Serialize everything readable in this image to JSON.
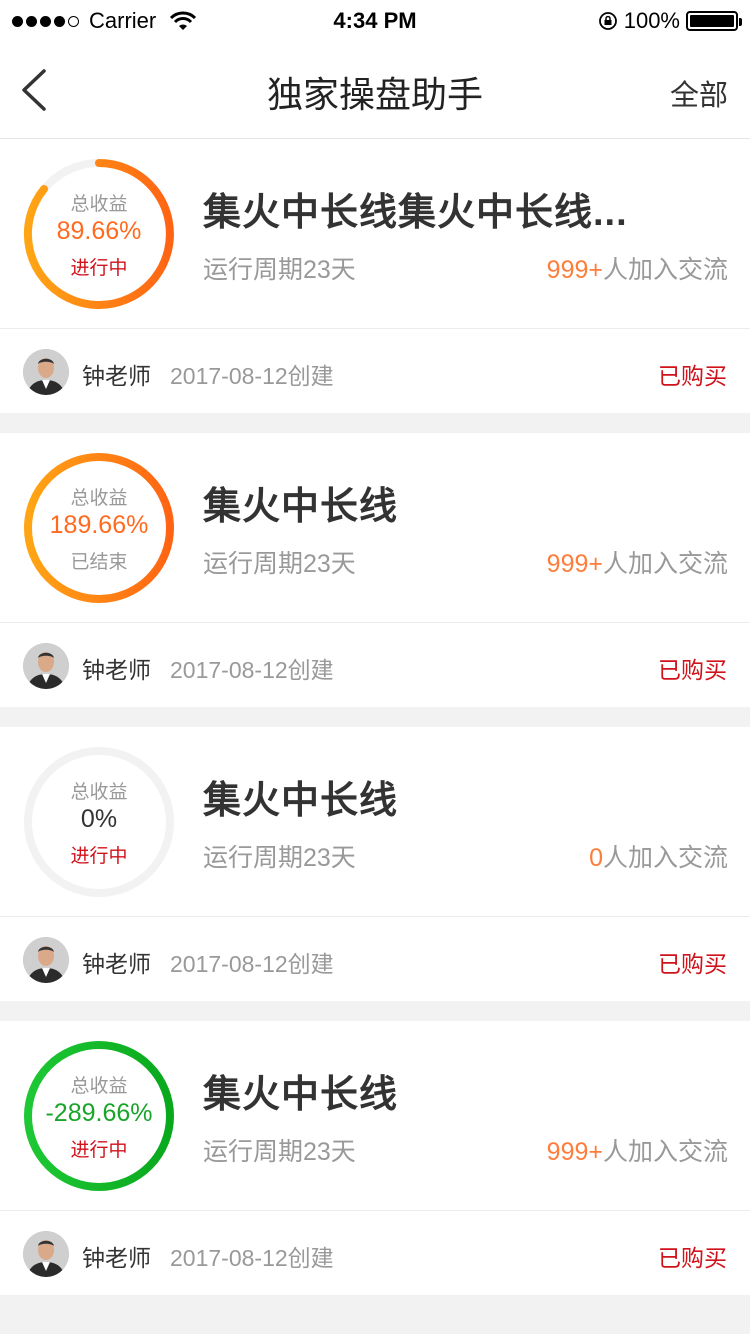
{
  "status_bar": {
    "carrier": "Carrier",
    "time": "4:34 PM",
    "battery": "100%"
  },
  "nav": {
    "title": "独家操盘助手",
    "right": "全部"
  },
  "colors": {
    "orange": "#ff7c3a",
    "green": "#19a52a",
    "red": "#d0121b",
    "gray": "#999999"
  },
  "cards": [
    {
      "ring_label": "总收益",
      "value": "89.66%",
      "status": "进行中",
      "title": "集火中长线集火中长线...",
      "period": "运行周期23天",
      "member_count": "999+",
      "member_suffix": "人加入交流",
      "teacher": "钟老师",
      "created": "2017-08-12创建",
      "action": "已购买"
    },
    {
      "ring_label": "总收益",
      "value": "189.66%",
      "status": "已结束",
      "title": "集火中长线",
      "period": "运行周期23天",
      "member_count": "999+",
      "member_suffix": "人加入交流",
      "teacher": "钟老师",
      "created": "2017-08-12创建",
      "action": "已购买"
    },
    {
      "ring_label": "总收益",
      "value": "0%",
      "status": "进行中",
      "title": "集火中长线",
      "period": "运行周期23天",
      "member_count": "0",
      "member_suffix": "人加入交流",
      "teacher": "钟老师",
      "created": "2017-08-12创建",
      "action": "已购买"
    },
    {
      "ring_label": "总收益",
      "value": "-289.66%",
      "status": "进行中",
      "title": "集火中长线",
      "period": "运行周期23天",
      "member_count": "999+",
      "member_suffix": "人加入交流",
      "teacher": "钟老师",
      "created": "2017-08-12创建",
      "action": "已购买"
    }
  ]
}
